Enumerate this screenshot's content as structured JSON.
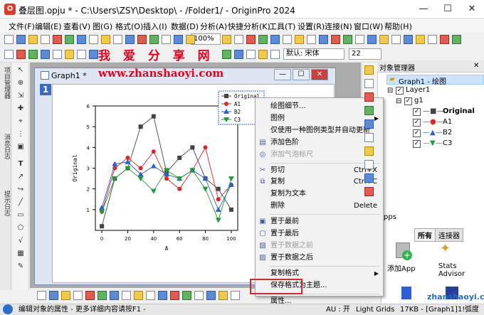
{
  "window": {
    "title": "叠层图.opju * - C:\\Users\\ZSY\\Desktop\\ - /Folder1/ - OriginPro 2024",
    "app_icon": "origin-app-icon"
  },
  "menubar": [
    "文件(F)",
    "编辑(E)",
    "查看(V)",
    "图(G)",
    "格式(O)",
    "插入(I)",
    "数据(D)",
    "分析(A)",
    "快捷分析(K)",
    "工具(T)",
    "设置(R)",
    "连接(N)",
    "窗口(W)",
    "帮助(H)"
  ],
  "toolbar": {
    "zoom": "100%",
    "font_name": "默认: 宋体",
    "font_size": "22"
  },
  "watermark": {
    "line1": "我 爱 分 享 网",
    "line2": "www.zhanshaoyi.com"
  },
  "left_tabs": [
    "项目管理器",
    "消息日志",
    "提示日志"
  ],
  "graph": {
    "title": "Graph1 *",
    "layer_number": "1"
  },
  "chart_data": {
    "type": "line",
    "x": [
      0,
      10,
      20,
      30,
      40,
      50,
      60,
      70,
      80,
      90,
      100
    ],
    "series": [
      {
        "name": "Original",
        "color": "#444444",
        "marker": "square",
        "values": [
          0.2,
          2.5,
          3.0,
          5.0,
          5.5,
          2.8,
          3.5,
          4.0,
          2.5,
          2.0,
          1.0
        ]
      },
      {
        "name": "A1",
        "color": "#e02424",
        "marker": "circle",
        "values": [
          0.9,
          3.0,
          3.5,
          3.0,
          3.8,
          2.5,
          2.0,
          2.9,
          4.0,
          1.5,
          2.2
        ]
      },
      {
        "name": "B2",
        "color": "#2a5fd6",
        "marker": "triangle-up",
        "values": [
          1.1,
          3.2,
          3.3,
          2.7,
          3.1,
          2.7,
          2.5,
          2.9,
          2.5,
          1.0,
          2.2
        ]
      },
      {
        "name": "C3",
        "color": "#1e9a3c",
        "marker": "triangle-down",
        "values": [
          0.9,
          2.5,
          3.0,
          2.5,
          1.9,
          2.9,
          2.5,
          2.9,
          2.0,
          0.5,
          2.5
        ]
      }
    ],
    "xlabel": "A",
    "ylabel": "Original",
    "xlim": [
      -5,
      105
    ],
    "ylim": [
      0,
      6
    ],
    "xticks": [
      0,
      20,
      40,
      60,
      80,
      100
    ],
    "yticks": [
      1,
      2,
      3,
      4,
      5,
      6
    ],
    "legend": "top-right"
  },
  "context_menu": [
    {
      "label": "绘图细节...",
      "icon": "",
      "shortcut": "",
      "disabled": false,
      "submenu": false
    },
    {
      "label": "图例",
      "icon": "",
      "shortcut": "",
      "disabled": false,
      "submenu": true
    },
    {
      "label": "仅使用一种图例类型并自动更新",
      "icon": "",
      "shortcut": "",
      "disabled": false,
      "submenu": false
    },
    {
      "label": "添加色阶",
      "icon": "colorscale-icon",
      "shortcut": "",
      "disabled": false,
      "submenu": false
    },
    {
      "label": "添加气泡标尺",
      "icon": "bubble-scale-icon",
      "shortcut": "",
      "disabled": true,
      "submenu": false
    },
    {
      "sep": true
    },
    {
      "label": "剪切",
      "icon": "scissors-icon",
      "shortcut": "Ctrl+X",
      "disabled": false,
      "submenu": false
    },
    {
      "label": "复制",
      "icon": "copy-icon",
      "shortcut": "Ctrl+C",
      "disabled": false,
      "submenu": false
    },
    {
      "label": "复制为文本",
      "icon": "",
      "shortcut": "",
      "disabled": false,
      "submenu": false
    },
    {
      "label": "删除",
      "icon": "",
      "shortcut": "Delete",
      "disabled": false,
      "submenu": false
    },
    {
      "sep": true
    },
    {
      "label": "置于最前",
      "icon": "bring-front-icon",
      "shortcut": "",
      "disabled": false,
      "submenu": false
    },
    {
      "label": "置于最后",
      "icon": "send-back-icon",
      "shortcut": "",
      "disabled": false,
      "submenu": false
    },
    {
      "label": "置于数据之前",
      "icon": "before-data-icon",
      "shortcut": "",
      "disabled": true,
      "submenu": false
    },
    {
      "label": "置于数据之后",
      "icon": "after-data-icon",
      "shortcut": "",
      "disabled": false,
      "submenu": false
    },
    {
      "sep": true
    },
    {
      "label": "复制格式",
      "icon": "",
      "shortcut": "",
      "disabled": false,
      "submenu": true
    },
    {
      "label": "保存格式为主题...",
      "icon": "",
      "shortcut": "",
      "disabled": false,
      "submenu": false
    },
    {
      "sep": true
    },
    {
      "label": "属性...",
      "icon": "",
      "shortcut": "",
      "disabled": false,
      "submenu": false
    }
  ],
  "object_manager": {
    "title": "对象管理器",
    "root": "Graph1 - 绘图",
    "layer": "Layer1",
    "group": "g1",
    "items": [
      "Original",
      "A1",
      "B2",
      "C3"
    ]
  },
  "apps": {
    "header": "pps",
    "tabs": [
      "所有",
      "连接器"
    ],
    "items": [
      "添加App",
      "Stats Advisor"
    ]
  },
  "status": {
    "left": "编辑对象的属性 - 更多详细内容请按F1 -",
    "au": "AU : 开",
    "grid": "Light Grids",
    "info": "17KB - [Graph1]1!",
    "unit": "弧度"
  },
  "watermark_corner": "zhanshaoyi.com"
}
